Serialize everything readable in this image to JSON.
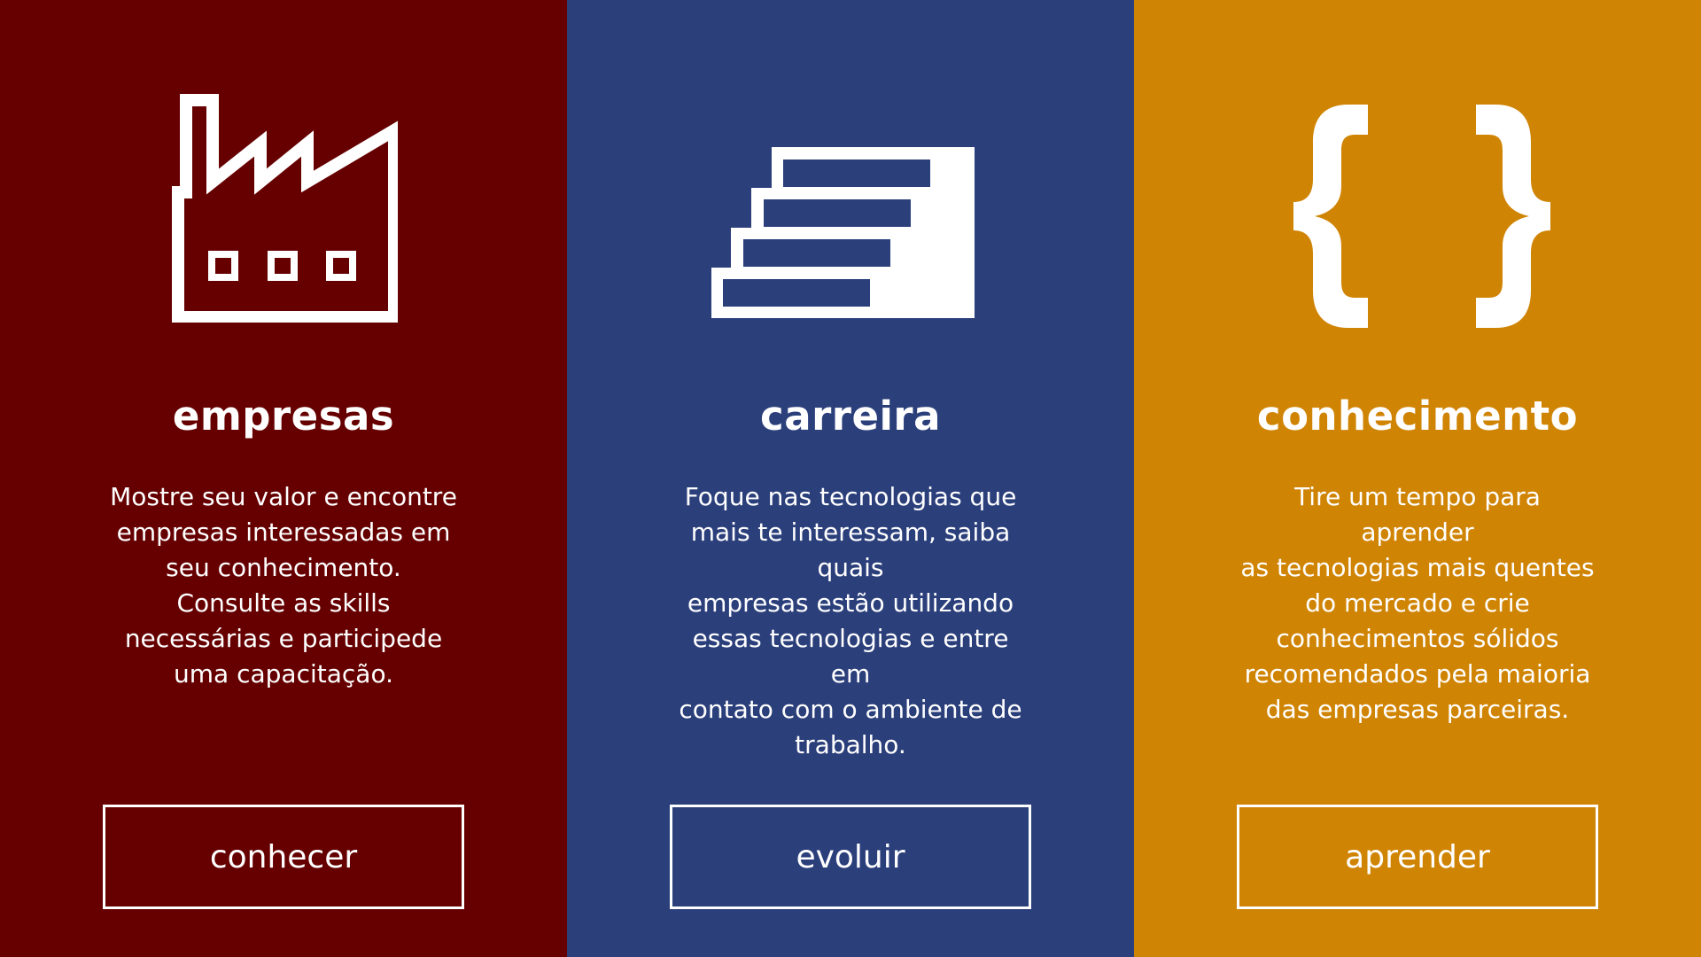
{
  "panels": [
    {
      "icon": "factory-icon",
      "title": "empresas",
      "description": "Mostre seu valor e encontre\nempresas interessadas em\nseu conhecimento.\nConsulte as skills\nnecessárias e participede\numa capacitação.",
      "button_label": "conhecer",
      "color": "#660000"
    },
    {
      "icon": "stairs-icon",
      "title": "carreira",
      "description": "Foque nas tecnologias que\nmais te interessam, saiba quais\nempresas estão utilizando\nessas tecnologias e entre em\ncontato com o ambiente de\ntrabalho.",
      "button_label": "evoluir",
      "color": "#2b3f7b"
    },
    {
      "icon": "curly-braces-icon",
      "title": "conhecimento",
      "description": "Tire um tempo para aprender\nas tecnologias mais quentes\ndo mercado e crie\nconhecimentos sólidos\nrecomendados pela maioria\ndas empresas parceiras.",
      "button_label": "aprender",
      "color": "#d08404"
    }
  ]
}
